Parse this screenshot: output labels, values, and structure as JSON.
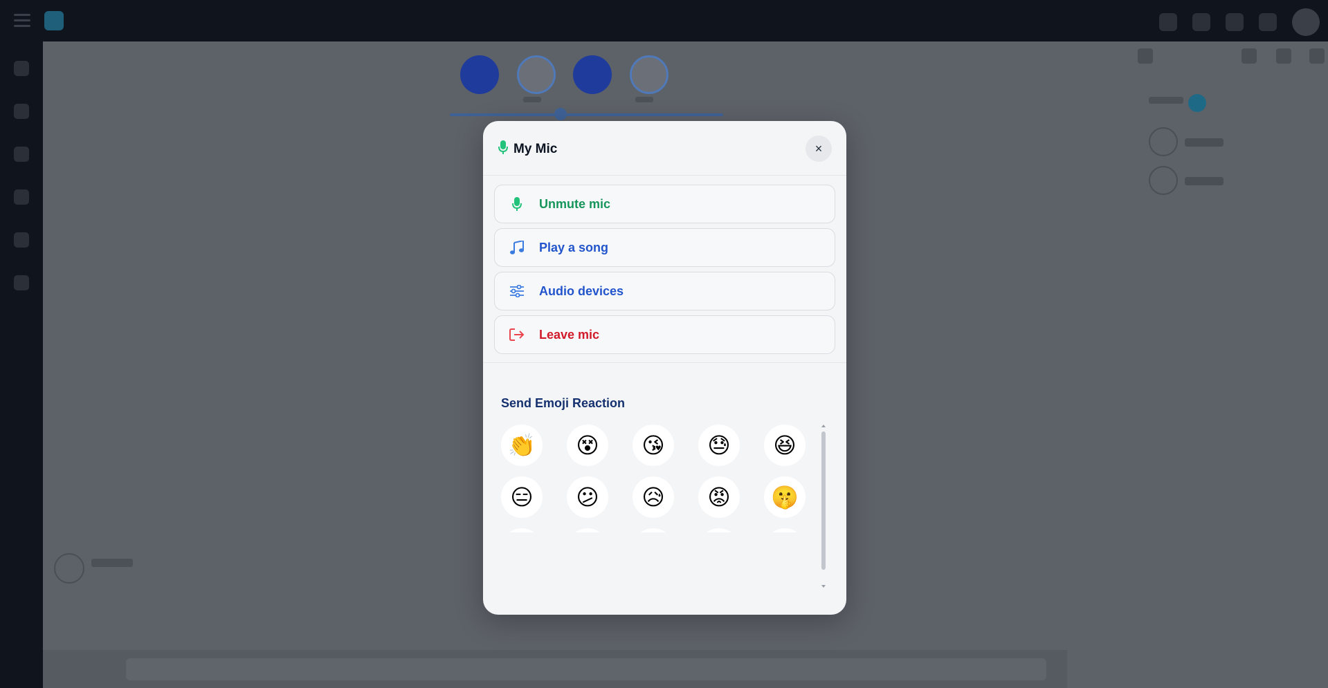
{
  "modal": {
    "title": "My Mic",
    "close_symbol": "×",
    "actions": [
      {
        "label": "Unmute mic",
        "icon": "microphone-icon",
        "color": "#16955a"
      },
      {
        "label": "Play a song",
        "icon": "music-note-icon",
        "color": "#2255cc"
      },
      {
        "label": "Audio devices",
        "icon": "sliders-icon",
        "color": "#2255cc"
      },
      {
        "label": "Leave mic",
        "icon": "leave-icon",
        "color": "#d11a2a"
      }
    ],
    "emoji_section": {
      "title": "Send Emoji Reaction",
      "emojis": [
        "👏",
        "😵",
        "😘",
        "😓",
        "😆",
        "😑",
        "😕",
        "😥",
        "😡",
        "🤫",
        "😴",
        "😍",
        "😊",
        "🤔",
        "😗",
        "👏",
        "😌",
        "😎",
        "😐",
        "😶"
      ]
    }
  },
  "colors": {
    "accent_green": "#16955a",
    "accent_blue": "#2255cc",
    "danger_red": "#d11a2a",
    "dark_nav": "#0f141d"
  }
}
